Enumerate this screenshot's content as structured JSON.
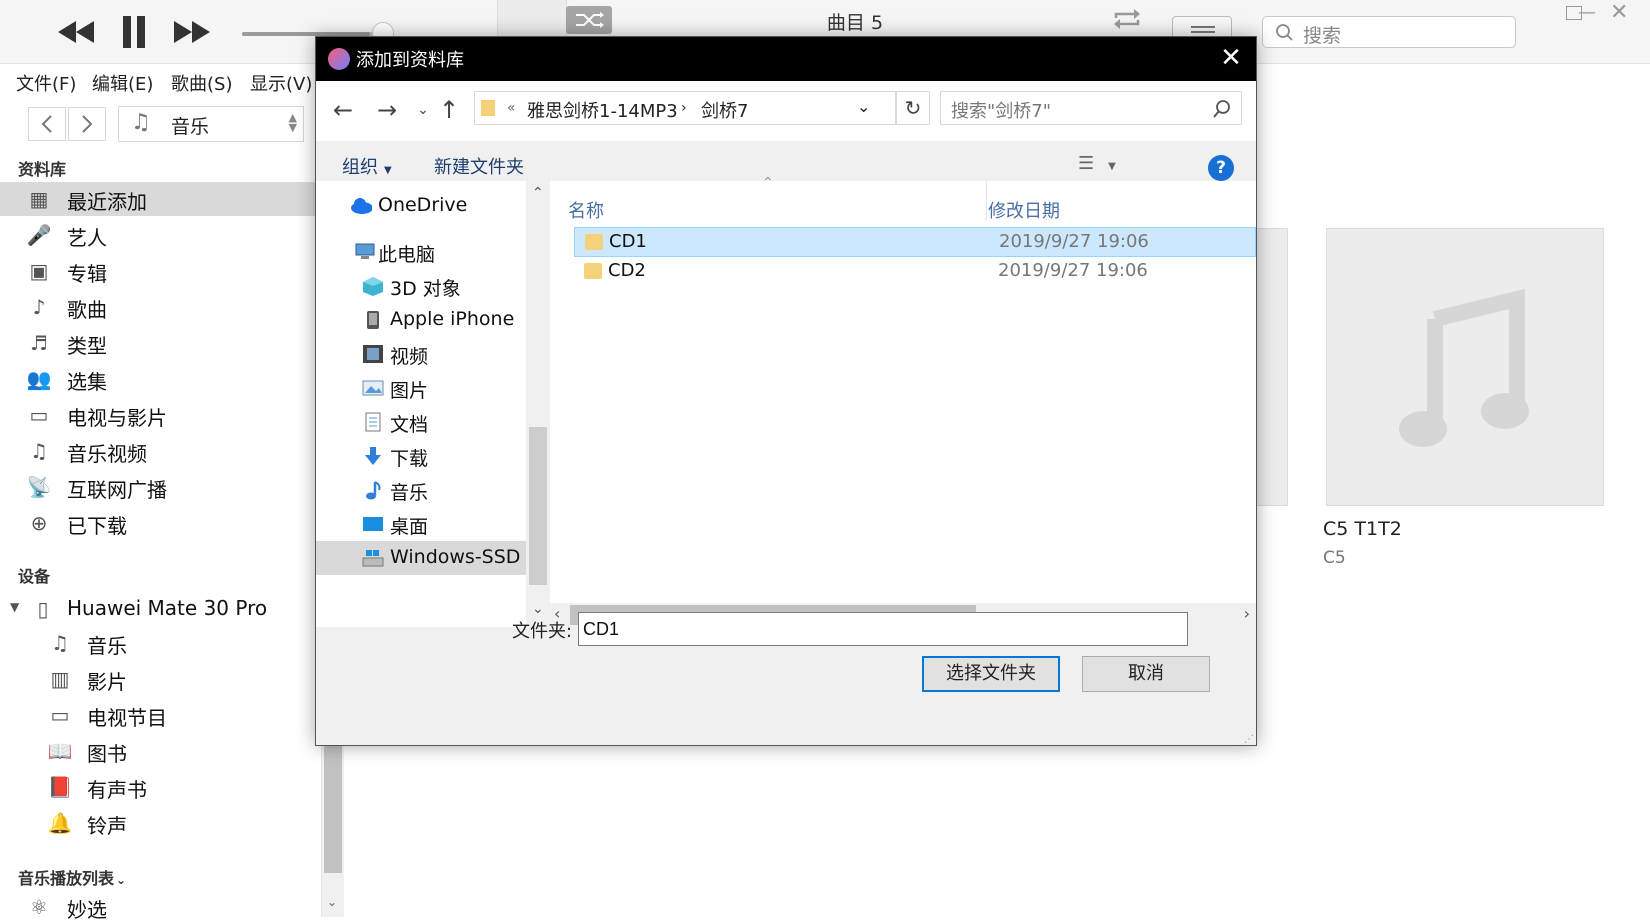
{
  "itunes": {
    "track_title": "曲目 5",
    "search_placeholder": "搜索",
    "menu": [
      "文件(F)",
      "编辑(E)",
      "歌曲(S)",
      "显示(V)"
    ],
    "media_kind": "音乐",
    "library_heading": "资料库",
    "library_items": [
      "最近添加",
      "艺人",
      "专辑",
      "歌曲",
      "类型",
      "选集",
      "电视与影片",
      "音乐视频",
      "互联网广播",
      "已下载"
    ],
    "devices_heading": "设备",
    "device_name": "Huawei Mate 30 Pro",
    "device_items": [
      "音乐",
      "影片",
      "电视节目",
      "图书",
      "有声书",
      "铃声"
    ],
    "playlists_heading": "音乐播放列表",
    "playlist_items": [
      "妙选"
    ],
    "album_title": "C5 T1T2",
    "album_artist": "C5"
  },
  "dialog": {
    "title": "添加到资料库",
    "breadcrumb": [
      "雅思剑桥1-14MP3",
      "剑桥7"
    ],
    "search_placeholder": "搜索\"剑桥7\"",
    "toolbar": {
      "organize": "组织",
      "new_folder": "新建文件夹"
    },
    "nav_items": [
      "OneDrive",
      "此电脑",
      "3D 对象",
      "Apple iPhone",
      "视频",
      "图片",
      "文档",
      "下载",
      "音乐",
      "桌面",
      "Windows-SSD ("
    ],
    "columns": {
      "name": "名称",
      "modified": "修改日期"
    },
    "files": [
      {
        "name": "CD1",
        "date": "2019/9/27 19:06"
      },
      {
        "name": "CD2",
        "date": "2019/9/27 19:06"
      }
    ],
    "folder_label": "文件夹:",
    "folder_value": "CD1",
    "select_button": "选择文件夹",
    "cancel_button": "取消"
  }
}
